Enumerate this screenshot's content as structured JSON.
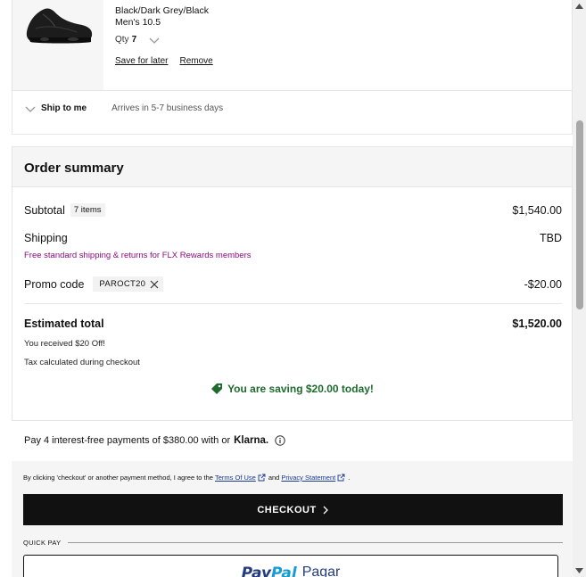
{
  "cart_item": {
    "color": "Black/Dark Grey/Black",
    "size": "Men's 10.5",
    "qty_label": "Qty",
    "qty_value": "7",
    "save_for_later": "Save for later",
    "remove": "Remove",
    "ship_label": "Ship to me",
    "ship_eta": "Arrives in 5-7 business days",
    "image_icon": "sneaker-icon"
  },
  "order_summary": {
    "title": "Order summary",
    "subtotal_label": "Subtotal",
    "subtotal_items": "7 items",
    "subtotal_value": "$1,540.00",
    "shipping_label": "Shipping",
    "shipping_value": "TBD",
    "free_shipping_note": "Free standard shipping & returns for FLX Rewards members",
    "promo_label": "Promo code",
    "promo_code": "PAROCT20",
    "promo_value": "-$20.00",
    "estimated_label": "Estimated total",
    "estimated_value": "$1,520.00",
    "received_note": "You received $20 Off!",
    "tax_note": "Tax calculated during checkout",
    "saving_message": "You are saving $20.00 today!",
    "saving_color": "#1e6b2e",
    "free_shipping_color": "#8b0c7d"
  },
  "klarna": {
    "text": "Pay 4 interest-free payments of $380.00 with or",
    "brand": "Klarna."
  },
  "checkout": {
    "terms_prefix": "By clicking 'checkout' or another payment method, I agree to the",
    "terms_link": "Terms Of Use",
    "terms_and": "and",
    "privacy_link": "Privacy Statement",
    "terms_suffix": ".",
    "checkout_label": "CHECKOUT",
    "quick_pay_label": "QUICK PAY",
    "paypal_part1": "Pay",
    "paypal_part2": "Pal",
    "paypal_action": "Pagar"
  }
}
